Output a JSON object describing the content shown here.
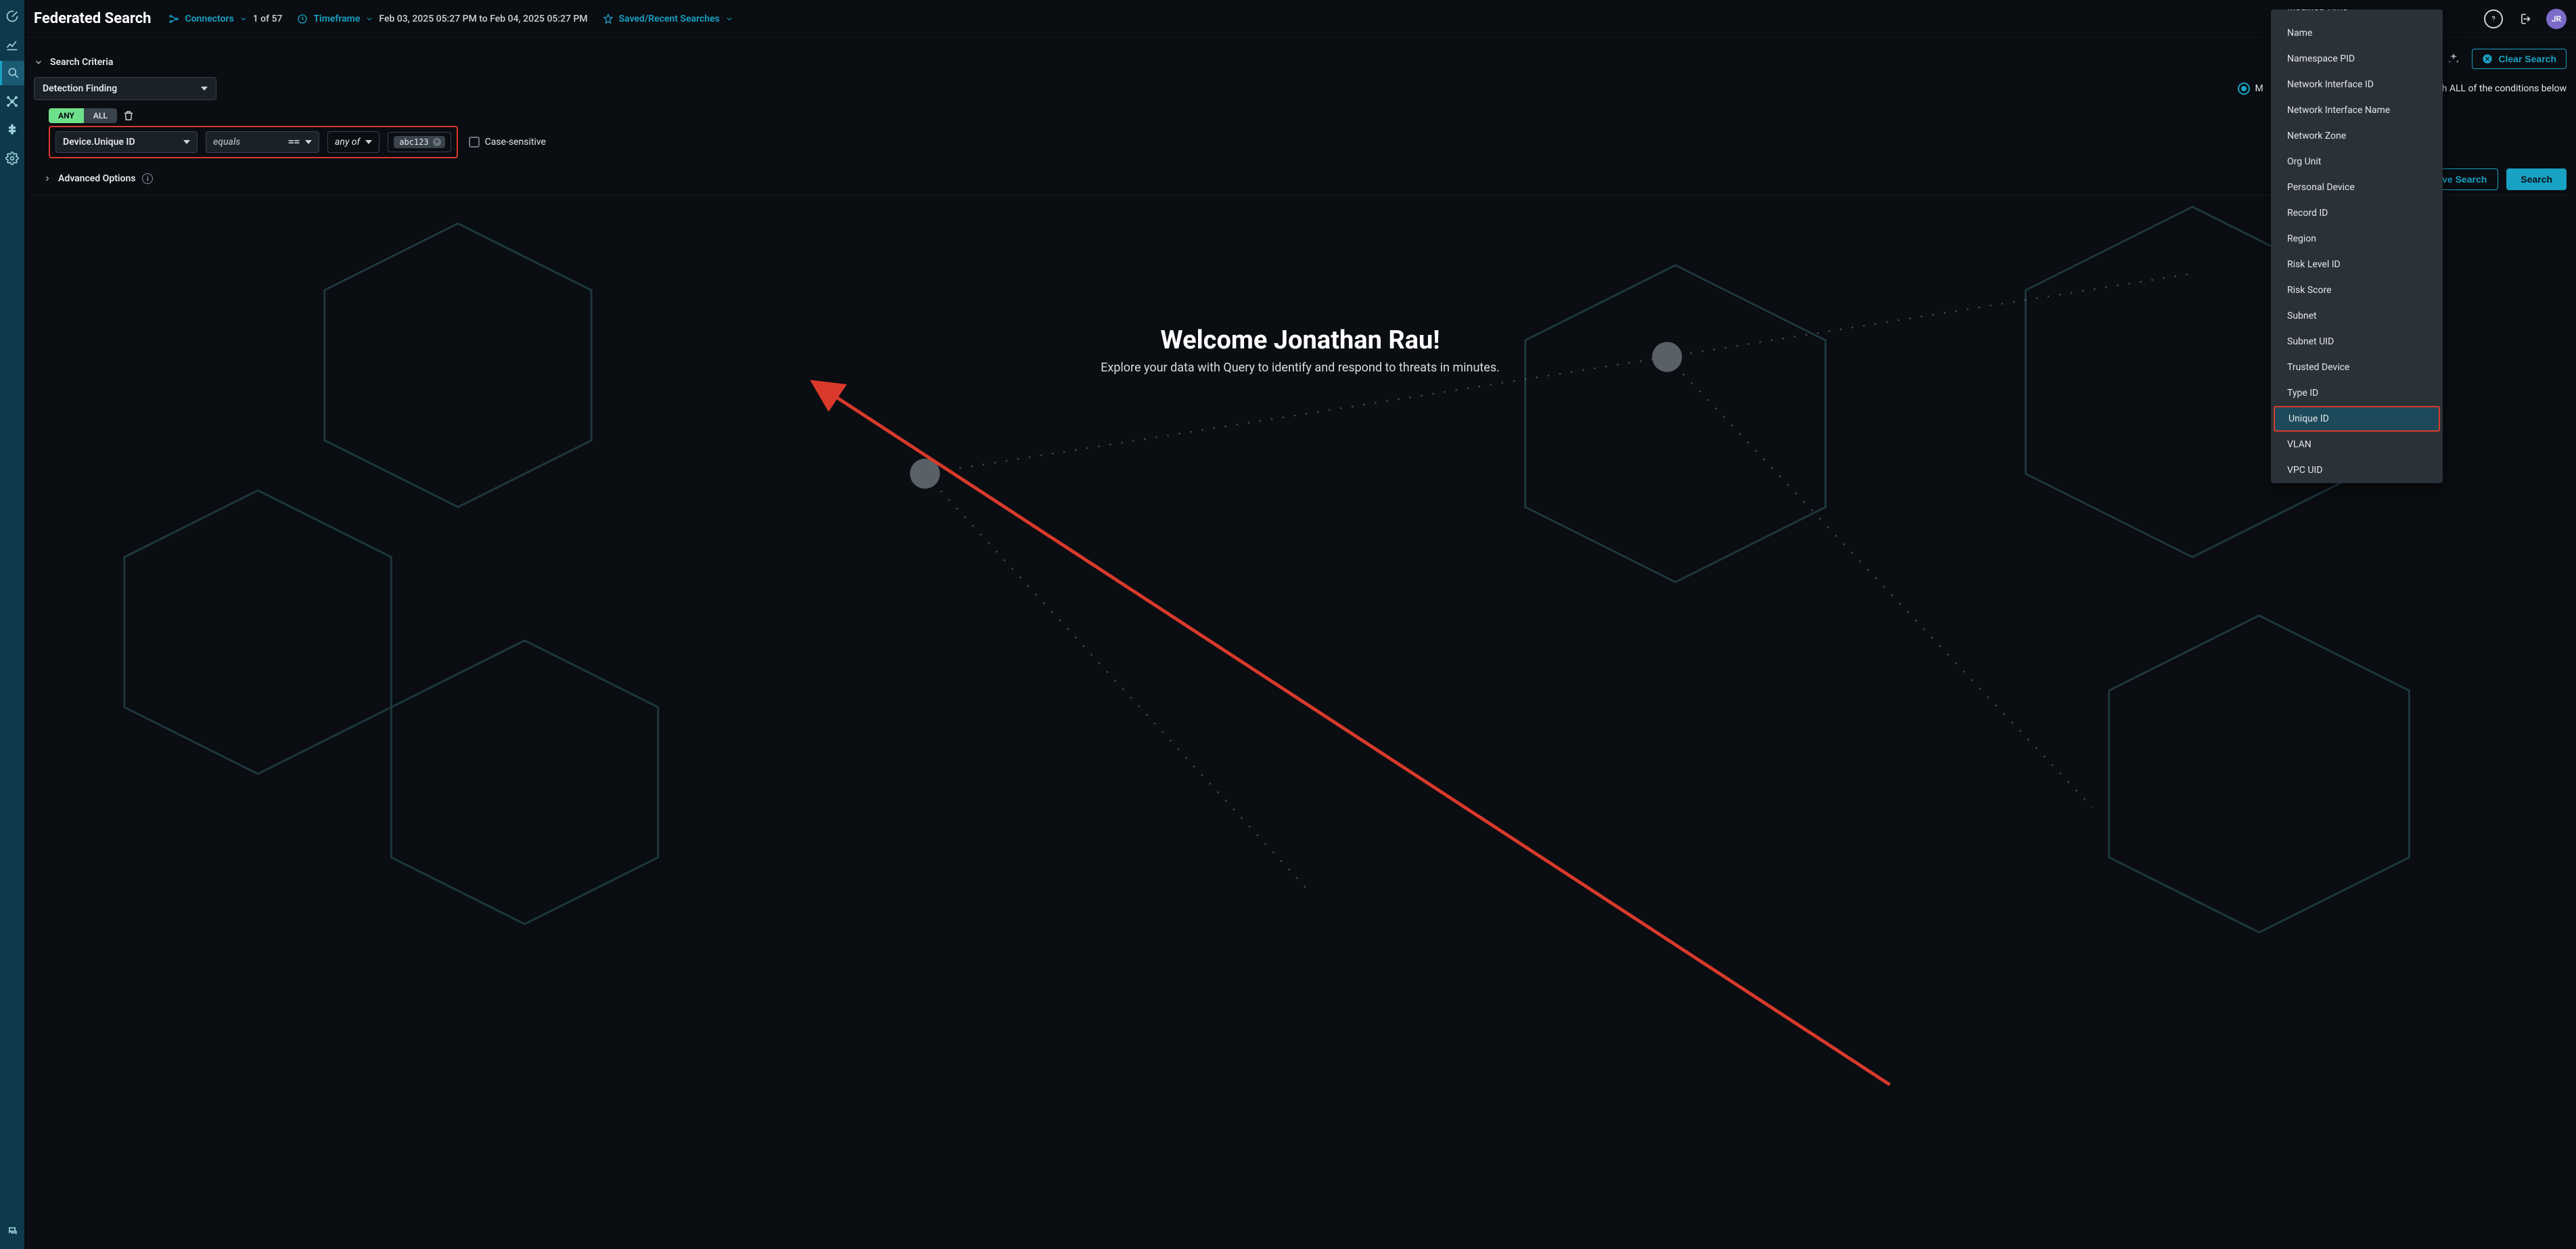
{
  "header": {
    "title": "Federated Search",
    "connectors_label": "Connectors",
    "connectors_count": "1 of 57",
    "timeframe_label": "Timeframe",
    "timeframe_value": "Feb 03, 2025 05:27 PM to Feb 04, 2025 05:27 PM",
    "saved_label": "Saved/Recent Searches",
    "avatar_initials": "JR"
  },
  "toolbar": {
    "clear_label": "Clear Search"
  },
  "criteria": {
    "header": "Search Criteria",
    "entity_select": "Detection Finding",
    "match_prefix": "M",
    "match_tail": "tch ALL of the conditions below",
    "any_label": "ANY",
    "all_label": "ALL",
    "field_value": "Device.Unique ID",
    "operator_label": "equals",
    "operator_symbol": "==",
    "anyof_label": "any of",
    "chip_value": "abc123",
    "case_label": "Case-sensitive",
    "advanced_label": "Advanced Options",
    "save_label": "Save Search",
    "search_label": "Search"
  },
  "hero": {
    "title": "Welcome Jonathan Rau!",
    "subtitle": "Explore your data with Query to identify and respond to threats in minutes."
  },
  "dropdown": {
    "items": [
      "Modified Time",
      "Name",
      "Namespace PID",
      "Network Interface ID",
      "Network Interface Name",
      "Network Zone",
      "Org Unit",
      "Personal Device",
      "Record ID",
      "Region",
      "Risk Level ID",
      "Risk Score",
      "Subnet",
      "Subnet UID",
      "Trusted Device",
      "Type ID",
      "Unique ID",
      "VLAN",
      "VPC UID"
    ],
    "selected_index": 16
  }
}
